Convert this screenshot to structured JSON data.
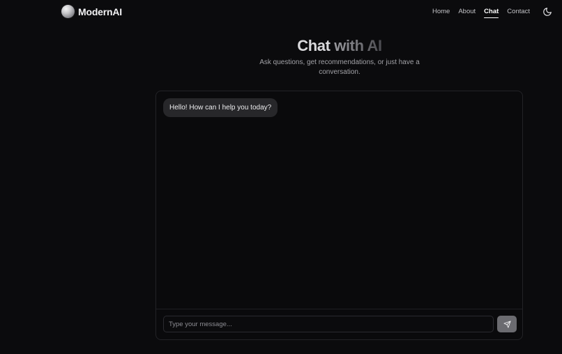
{
  "brand": {
    "name": "ModernAI"
  },
  "nav": {
    "items": [
      {
        "label": "Home",
        "active": false
      },
      {
        "label": "About",
        "active": false
      },
      {
        "label": "Chat",
        "active": true
      },
      {
        "label": "Contact",
        "active": false
      }
    ],
    "theme_toggle_icon": "moon-icon"
  },
  "hero": {
    "title_part1": "Chat",
    "title_part2": "with AI",
    "subtitle": "Ask questions, get recommendations, or just have a conversation."
  },
  "chat": {
    "messages": [
      {
        "role": "assistant",
        "text": "Hello! How can I help you today?"
      }
    ],
    "input": {
      "value": "",
      "placeholder": "Type your message..."
    },
    "send_icon": "send-icon"
  },
  "colors": {
    "background": "#0b0b0d",
    "panel_border": "#232327",
    "bubble": "#27272a",
    "send_button": "#6b6b70"
  }
}
